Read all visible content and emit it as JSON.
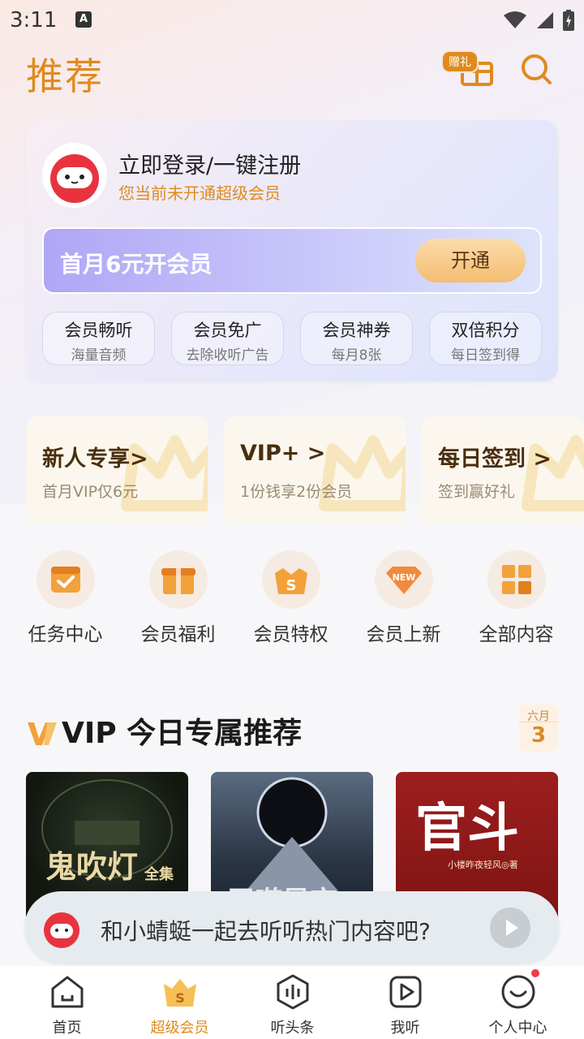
{
  "status_bar": {
    "time": "3:11",
    "a_icon": "A"
  },
  "header": {
    "title": "推荐",
    "gift_badge": "赠礼"
  },
  "member_card": {
    "login_title": "立即登录/一键注册",
    "login_subtitle": "您当前未开通超级会员",
    "offer_text": "首月6元开会员",
    "open_button": "开通",
    "perks": [
      {
        "title": "会员畅听",
        "subtitle": "海量音频"
      },
      {
        "title": "会员免广",
        "subtitle": "去除收听广告"
      },
      {
        "title": "会员神券",
        "subtitle": "每月8张"
      },
      {
        "title": "双倍积分",
        "subtitle": "每日签到得"
      }
    ]
  },
  "promos": [
    {
      "title": "新人专享>",
      "subtitle": "首月VIP仅6元"
    },
    {
      "title": "VIP+ >",
      "subtitle": "1份钱享2份会员"
    },
    {
      "title": "每日签到 >",
      "subtitle": "签到赢好礼"
    }
  ],
  "quick_entries": [
    {
      "label": "任务中心",
      "icon": "task-calendar-icon"
    },
    {
      "label": "会员福利",
      "icon": "gift-box-icon"
    },
    {
      "label": "会员特权",
      "icon": "privilege-crown-icon"
    },
    {
      "label": "会员上新",
      "icon": "new-badge-icon"
    },
    {
      "label": "全部内容",
      "icon": "grid-icon"
    }
  ],
  "vip_section": {
    "title": "VIP 今日专属推荐",
    "calendar_month": "六月",
    "calendar_day": "3",
    "books": [
      {
        "cover_text": "鬼吹灯",
        "cover_badge": "全集"
      },
      {
        "cover_text": "吞噬星空"
      },
      {
        "cover_text": "官斗",
        "cover_author": "小楼昨夜轻风◎著"
      }
    ]
  },
  "floating_banner": {
    "text": "和小蜻蜓一起去听听热门内容吧?"
  },
  "bottom_nav": [
    {
      "label": "首页",
      "icon": "home-icon",
      "active": false
    },
    {
      "label": "超级会员",
      "icon": "vip-crown-icon",
      "active": true
    },
    {
      "label": "听头条",
      "icon": "headline-audio-icon",
      "active": false
    },
    {
      "label": "我听",
      "icon": "play-square-icon",
      "active": false
    },
    {
      "label": "个人中心",
      "icon": "profile-smile-icon",
      "active": false
    }
  ],
  "colors": {
    "accent": "#e08a1e",
    "notification": "#ef3b4a"
  }
}
